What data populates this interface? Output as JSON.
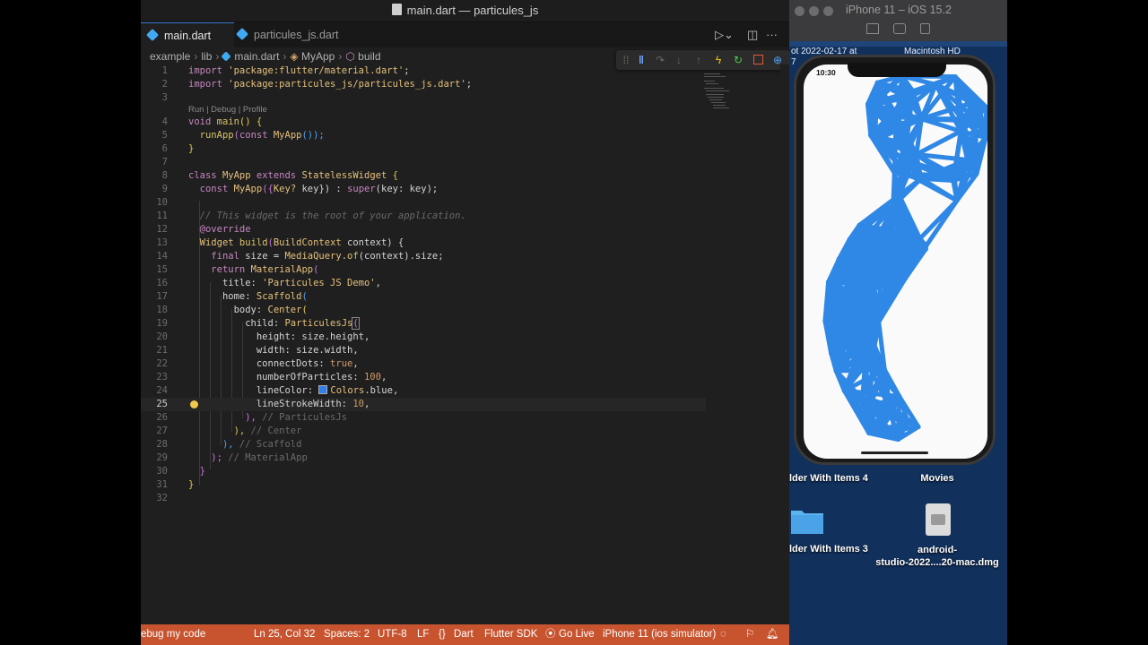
{
  "window_title": "main.dart — particules_js",
  "tabs": [
    {
      "label": "main.dart",
      "active": true
    },
    {
      "label": "particules_js.dart",
      "active": false
    }
  ],
  "breadcrumb": [
    "example",
    "lib",
    "main.dart",
    "MyApp",
    "build"
  ],
  "code_lens": "Run | Debug | Profile",
  "code_lines": [
    {
      "n": "1"
    },
    {
      "n": "2"
    },
    {
      "n": "3"
    },
    {
      "n": "4"
    },
    {
      "n": "5"
    },
    {
      "n": "6"
    },
    {
      "n": "7"
    },
    {
      "n": "8"
    },
    {
      "n": "9"
    },
    {
      "n": "10"
    },
    {
      "n": "11"
    },
    {
      "n": "12"
    },
    {
      "n": "13"
    },
    {
      "n": "14"
    },
    {
      "n": "15"
    },
    {
      "n": "16"
    },
    {
      "n": "17"
    },
    {
      "n": "18"
    },
    {
      "n": "19"
    },
    {
      "n": "20"
    },
    {
      "n": "21"
    },
    {
      "n": "22"
    },
    {
      "n": "23"
    },
    {
      "n": "24"
    },
    {
      "n": "25"
    },
    {
      "n": "26"
    },
    {
      "n": "27"
    },
    {
      "n": "28"
    },
    {
      "n": "29"
    },
    {
      "n": "30"
    },
    {
      "n": "31"
    },
    {
      "n": "32"
    }
  ],
  "code": {
    "l1_kw": "import",
    "l1_str": "'package:flutter/material.dart'",
    "l1_end": ";",
    "l2_kw": "import",
    "l2_str": "'package:particules_js/particules_js.dart'",
    "l2_end": ";",
    "l4_type": "void",
    "l4_fn": "main",
    "l4_rest": "() {",
    "l5_fn": "runApp",
    "l5_a": "(",
    "l5_kw": "const",
    "l5_cls": "MyApp",
    "l5_b": "());",
    "l7": "}",
    "l8_kw": "class",
    "l8_cls": "MyApp",
    "l8_kw2": "extends",
    "l8_cls2": "StatelessWidget",
    "l8_end": " {",
    "l9_kw": "const",
    "l9_cls": "MyApp",
    "l9_a": "({",
    "l9_type": "Key?",
    "l9_b": " key}) : ",
    "l9_super": "super",
    "l9_c": "(key: key);",
    "l11": "// This widget is the root of your application.",
    "l12": "@override",
    "l13_type": "Widget",
    "l13_fn": "build",
    "l13_a": "(",
    "l13_cls": "BuildContext",
    "l13_b": " context) {",
    "l14_kw": "final",
    "l14_a": " size = ",
    "l14_cls": "MediaQuery",
    "l14_b": ".",
    "l14_fn": "of",
    "l14_c": "(context).size;",
    "l15_kw": "return",
    "l15_cls": "MaterialApp",
    "l15_a": "(",
    "l16_a": "title: ",
    "l16_str": "'Particules JS Demo'",
    "l16_b": ",",
    "l17_a": "home: ",
    "l17_cls": "Scaffold",
    "l17_b": "(",
    "l18_a": "body: ",
    "l18_cls": "Center",
    "l18_b": "(",
    "l19_a": "child: ",
    "l19_cls": "ParticulesJs",
    "l19_b": "(",
    "l20": "height: size.height,",
    "l21": "width: size.width,",
    "l22_a": "connectDots: ",
    "l22_kw": "true",
    "l22_b": ",",
    "l23_a": "numberOfParticles: ",
    "l23_num": "100",
    "l23_b": ",",
    "l24_a": "lineColor: ",
    "l24_cls": "Colors",
    "l24_b": ".blue,",
    "l25_a": "lineStrokeWidth: ",
    "l25_num": "10",
    "l25_b": ",",
    "l26_a": "), ",
    "l26_c": "// ParticulesJs",
    "l27_a": "), ",
    "l27_c": "// Center",
    "l28_a": "), ",
    "l28_c": "// Scaffold",
    "l29_a": "); ",
    "l29_c": "// MaterialApp",
    "l30": "}",
    "l31": "}"
  },
  "statusbar": {
    "debug": "ebug my code",
    "position": "Ln 25, Col 32",
    "spaces": "Spaces: 2",
    "encoding": "UTF-8",
    "eol": "LF",
    "braces": "{}",
    "language": "Dart",
    "sdk": "Flutter SDK",
    "go_live": "Go Live",
    "device": "iPhone 11 (ios simulator)"
  },
  "simulator": {
    "title": "iPhone 11 – iOS 15.2",
    "time": "10:30"
  },
  "desktop": {
    "frag1": "ot 2022-02-17 at",
    "frag1b": "7",
    "frag2": "Macintosh HD",
    "items": [
      {
        "label": "lder With Items 4"
      },
      {
        "label": "Movies"
      },
      {
        "label": "lder With Items 3"
      },
      {
        "label": "android-\nstudio-2022....20-mac.dmg"
      }
    ]
  },
  "colors": {
    "statusbar": "#c7542f",
    "particle_lines": "#2f88e6",
    "accent_tab": "#3a7bd5"
  },
  "icons": [
    "file-icon",
    "dart-icon",
    "debug-pause-icon",
    "debug-step-over-icon",
    "debug-step-into-icon",
    "debug-step-out-icon",
    "hot-reload-icon",
    "hot-restart-icon",
    "debug-stop-icon",
    "inspector-icon",
    "lightbulb-icon",
    "broadcast-icon",
    "bell-icon",
    "person-icon",
    "home-icon",
    "camera-icon",
    "rotate-icon",
    "folder-icon",
    "dmg-icon"
  ]
}
